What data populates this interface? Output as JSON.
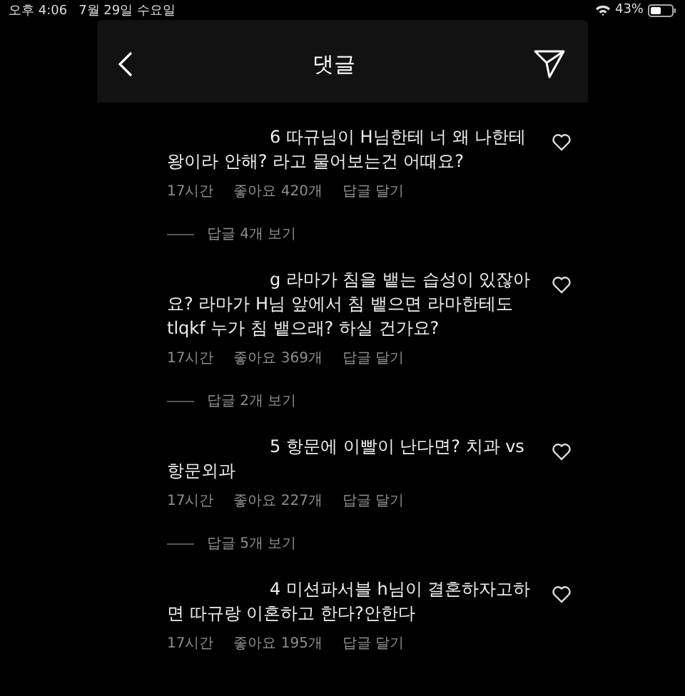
{
  "status_bar": {
    "time": "오후 4:06",
    "date": "7월 29일 수요일",
    "battery": "43%"
  },
  "header": {
    "title": "댓글"
  },
  "comments": [
    {
      "text": "6 따규님이 H님한테 너 왜 나한테 왕이라 안해? 라고 물어보는건 어때요?",
      "age": "17시간",
      "likes": "좋아요 420개",
      "reply": "답글 달기",
      "view_replies": "답글 4개 보기",
      "liked": false
    },
    {
      "text": "g 라마가 침을 뱉는 습성이 있잖아요? 라마가 H님 앞에서 침 뱉으면 라마한테도 tlqkf 누가 침 뱉으래? 하실 건가요?",
      "age": "17시간",
      "likes": "좋아요 369개",
      "reply": "답글 달기",
      "view_replies": "답글 2개 보기",
      "liked": false
    },
    {
      "text": "5 항문에 이빨이 난다면? 치과 vs 항문외과",
      "age": "17시간",
      "likes": "좋아요 227개",
      "reply": "답글 달기",
      "view_replies": "답글 5개 보기",
      "liked": false
    },
    {
      "text": "4 미션파서블 h님이 결혼하자고하면 따규랑 이혼하고 한다?안한다",
      "age": "17시간",
      "likes": "좋아요 195개",
      "reply": "답글 달기",
      "liked": false
    }
  ]
}
